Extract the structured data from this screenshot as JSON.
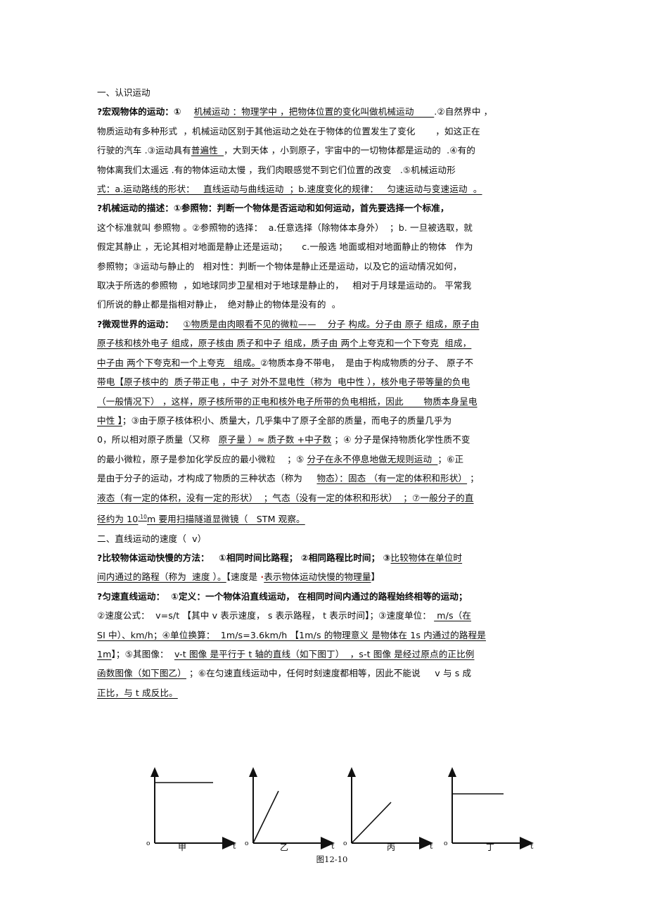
{
  "document": {
    "section1_title": "一、认识运动",
    "lines": [
      {
        "id": "l1",
        "parts": [
          {
            "t": "?宏观物体的运动：①    ",
            "u": false,
            "b": true
          },
          {
            "t": "机械运动 ：物理学中 ，把物体位置的变化叫做机械运动       ",
            "u": true,
            "b": false
          },
          {
            "t": ".②自然界中 ，",
            "u": false,
            "b": false
          }
        ]
      },
      {
        "id": "l2",
        "parts": [
          {
            "t": "物质运动有多种形式  ，机械运动区别于其他运动之处在于物体的位置发生了变化       ，如这正在",
            "u": false,
            "b": false
          }
        ]
      },
      {
        "id": "l3",
        "parts": [
          {
            "t": "行驶的汽车 .③运动具有",
            "u": false,
            "b": false
          },
          {
            "t": "普遍性  ",
            "u": true,
            "b": false
          },
          {
            "t": "，大到天体 ，小到原子，宇宙中的一切物体都是运动的  .④有的",
            "u": false,
            "b": false
          }
        ]
      },
      {
        "id": "l4",
        "parts": [
          {
            "t": "物体离我们太遥远 .有的物体运动太慢 ，我们肉眼感觉不到它们位置的改变   .⑤机械运动形",
            "u": false,
            "b": false
          }
        ]
      },
      {
        "id": "l5",
        "parts": [
          {
            "t": "式：a.运动路线的形状：   直线运动与曲线运动  ；b.速度变化的规律：   匀速运动与变速运动  。",
            "u": true,
            "b": false
          }
        ]
      },
      {
        "id": "l6",
        "parts": [
          {
            "t": "?机械运动的描述：①参照物：判断一个物体是否运动和如何运动，首先要选择一个标准，",
            "u": false,
            "b": true
          }
        ]
      },
      {
        "id": "l7",
        "parts": [
          {
            "t": "这个标准就叫 参照物 。②参照物的选择：  a.任意选择（除物体本身外）  ；b. 一旦被选取，就",
            "u": false,
            "b": false
          }
        ]
      },
      {
        "id": "l8",
        "parts": [
          {
            "t": "假定其静止 ，无论其相对地面是静止还是运动；     c.一般选 地面或相对地面静止的物体   作为",
            "u": false,
            "b": false
          }
        ]
      },
      {
        "id": "l9",
        "parts": [
          {
            "t": "参照物；③运动与静止的   相对性：判断一个物体是静止还是运动，以及它的运动情况如何，",
            "u": false,
            "b": false
          }
        ]
      },
      {
        "id": "l10",
        "parts": [
          {
            "t": "取决于所选的参照物  ，如地球同步卫星相对于地球是静止的，   相对于月球是运动的。 平常我",
            "u": false,
            "b": false
          }
        ]
      },
      {
        "id": "l11",
        "parts": [
          {
            "t": "们所说的静止都是指相对静止，  绝对静止的物体是没有的  。",
            "u": false,
            "b": false
          }
        ]
      },
      {
        "id": "l12",
        "parts": [
          {
            "t": "?微观世界的运动：   ",
            "u": false,
            "b": true
          },
          {
            "t": "①物质是由肉眼看不见的微粒——    分子 构成。分子由 原子 组成，原子由",
            "u": true,
            "b": false
          }
        ]
      },
      {
        "id": "l13",
        "parts": [
          {
            "t": "原子核和核外电子 组成，原子核由 质子和中子 组成，质子由 两个上夸克和一个下夸克  组成，",
            "u": true,
            "b": false
          }
        ]
      },
      {
        "id": "l14",
        "parts": [
          {
            "t": "中子由 两个下夸克和一个上夸克   组成。",
            "u": true,
            "b": false
          },
          {
            "t": "②物质本身不带电，  是由于构成物质的分子、 原子不",
            "u": false,
            "b": false
          }
        ]
      },
      {
        "id": "l15",
        "parts": [
          {
            "t": "带电【原子核中的  质子带正电 ，中子 对外不显电性（称为  电中性 ），核外电子带等量的负电",
            "u": true,
            "b": false
          }
        ]
      },
      {
        "id": "l16",
        "parts": [
          {
            "t": "（一般情况下） ，这样，原子核所带的正电和核外电子所带的负电相抵，因此       物质本身呈电",
            "u": true,
            "b": false
          }
        ]
      },
      {
        "id": "l17",
        "parts": [
          {
            "t": "中性 】",
            "u": true,
            "b": false
          },
          {
            "t": "；③由于原子核体积小、质量大，几乎集中了原子全部的质量，而电子的质量几乎为",
            "u": false,
            "b": false
          }
        ]
      },
      {
        "id": "l18",
        "parts": [
          {
            "t": "0，所以相对原子质量（又称   ",
            "u": false,
            "b": false
          },
          {
            "t": "原子量 ）≈ 质子数 +中子数",
            "u": true,
            "b": false
          },
          {
            "t": " ；④ 分子是保持物质化学性质不变",
            "u": false,
            "b": false
          }
        ]
      },
      {
        "id": "l19",
        "parts": [
          {
            "t": "的最小微粒，原子是参加化学反应的最小微粒    ；⑤ ",
            "u": false,
            "b": false
          },
          {
            "t": "分子在永不停息地做无规则运动  ",
            "u": true,
            "b": false
          },
          {
            "t": "；⑥正",
            "u": false,
            "b": false
          }
        ]
      },
      {
        "id": "l20",
        "parts": [
          {
            "t": "是由于分子的运动，才构成了物质的三种状态（称为     ",
            "u": false,
            "b": false
          },
          {
            "t": "物态）：固态 （有一定的体积和形状）",
            "u": true,
            "b": false
          },
          {
            "t": " ；",
            "u": false,
            "b": false
          }
        ]
      },
      {
        "id": "l21",
        "parts": [
          {
            "t": "液态（有一定的体积，没有一定的形状）  ；气态（没有一定的体积和形状）  ；⑦一般分子的直",
            "u": true,
            "b": false
          }
        ]
      },
      {
        "id": "l22",
        "parts": [
          {
            "t": "径约为 10",
            "u": true,
            "b": false
          },
          {
            "t": "-10",
            "u": true,
            "b": false,
            "sup": true
          },
          {
            "t": "m 要用扫描隧道显微镜（   STM 观察。",
            "u": true,
            "b": false
          }
        ]
      },
      {
        "id": "l23",
        "parts": [
          {
            "t": "二、直线运动的速度（  v）",
            "u": false,
            "b": false
          }
        ]
      },
      {
        "id": "l24",
        "parts": [
          {
            "t": "?比较物体运动快慢的方法：   ①相同时间比路程； ②相同路程比时间； ③",
            "u": false,
            "b": true
          },
          {
            "t": "比较物体在单位时",
            "u": true,
            "b": false
          }
        ]
      },
      {
        "id": "l25",
        "parts": [
          {
            "t": "间内通过的路程（称为  速度 ）。",
            "u": true,
            "b": false
          },
          {
            "t": "【速度是 ",
            "u": false,
            "b": false
          },
          {
            "t": "·",
            "u": false,
            "b": false,
            "dot": true
          },
          {
            "t": "表示物体运动快慢的物理量",
            "u": true,
            "b": false
          },
          {
            "t": "】",
            "u": false,
            "b": false
          }
        ]
      },
      {
        "id": "l26",
        "parts": [
          {
            "t": "?匀速直线运动：  ①定义：一个物体沿直线运动， 在相同时间内通过的路程始终相等的运动；",
            "u": false,
            "b": true
          }
        ]
      },
      {
        "id": "l27",
        "parts": [
          {
            "t": "②速度公式：  v=s/t 【其中 v 表示速度， s 表示路程， t 表示时间】；③速度单位： ",
            "u": false,
            "b": false
          },
          {
            "t": " m/s（在",
            "u": true,
            "b": false
          }
        ]
      },
      {
        "id": "l28",
        "parts": [
          {
            "t": "SI 中）、km/h；④单位换算：  1m/s=3.6km/h 【1m/s 的物理意义 是物体在 1s 内通过的路程是",
            "u": true,
            "b": false
          }
        ]
      },
      {
        "id": "l29",
        "parts": [
          {
            "t": "1m",
            "u": true,
            "b": false
          },
          {
            "t": "】；⑤其图像：  ",
            "u": false,
            "b": false
          },
          {
            "t": "v-t 图像 是平行于 t 轴的直线（如下图丁）  ，s-t 图像 是经过原点的正比例",
            "u": true,
            "b": false
          }
        ]
      },
      {
        "id": "l30",
        "parts": [
          {
            "t": "函数图像（如下图乙）",
            "u": true,
            "b": false
          },
          {
            "t": " ；⑥在匀速直线运动中，任何时刻速度都相等，因此不能说     v 与 s 成",
            "u": false,
            "b": false
          }
        ]
      },
      {
        "id": "l31",
        "parts": [
          {
            "t": "正比，与 t 成反比。",
            "u": true,
            "b": false
          }
        ]
      }
    ],
    "figures": {
      "caption": "图12-10",
      "items": [
        {
          "label": "甲",
          "origin": "o",
          "xaxis": "t",
          "type": "horizontal-high"
        },
        {
          "label": "乙",
          "origin": "o",
          "xaxis": "t",
          "type": "steep-line"
        },
        {
          "label": "丙",
          "origin": "o",
          "xaxis": "t",
          "type": "shallow-line"
        },
        {
          "label": "丁",
          "origin": "o",
          "xaxis": "t",
          "type": "horizontal-mid"
        }
      ]
    }
  }
}
